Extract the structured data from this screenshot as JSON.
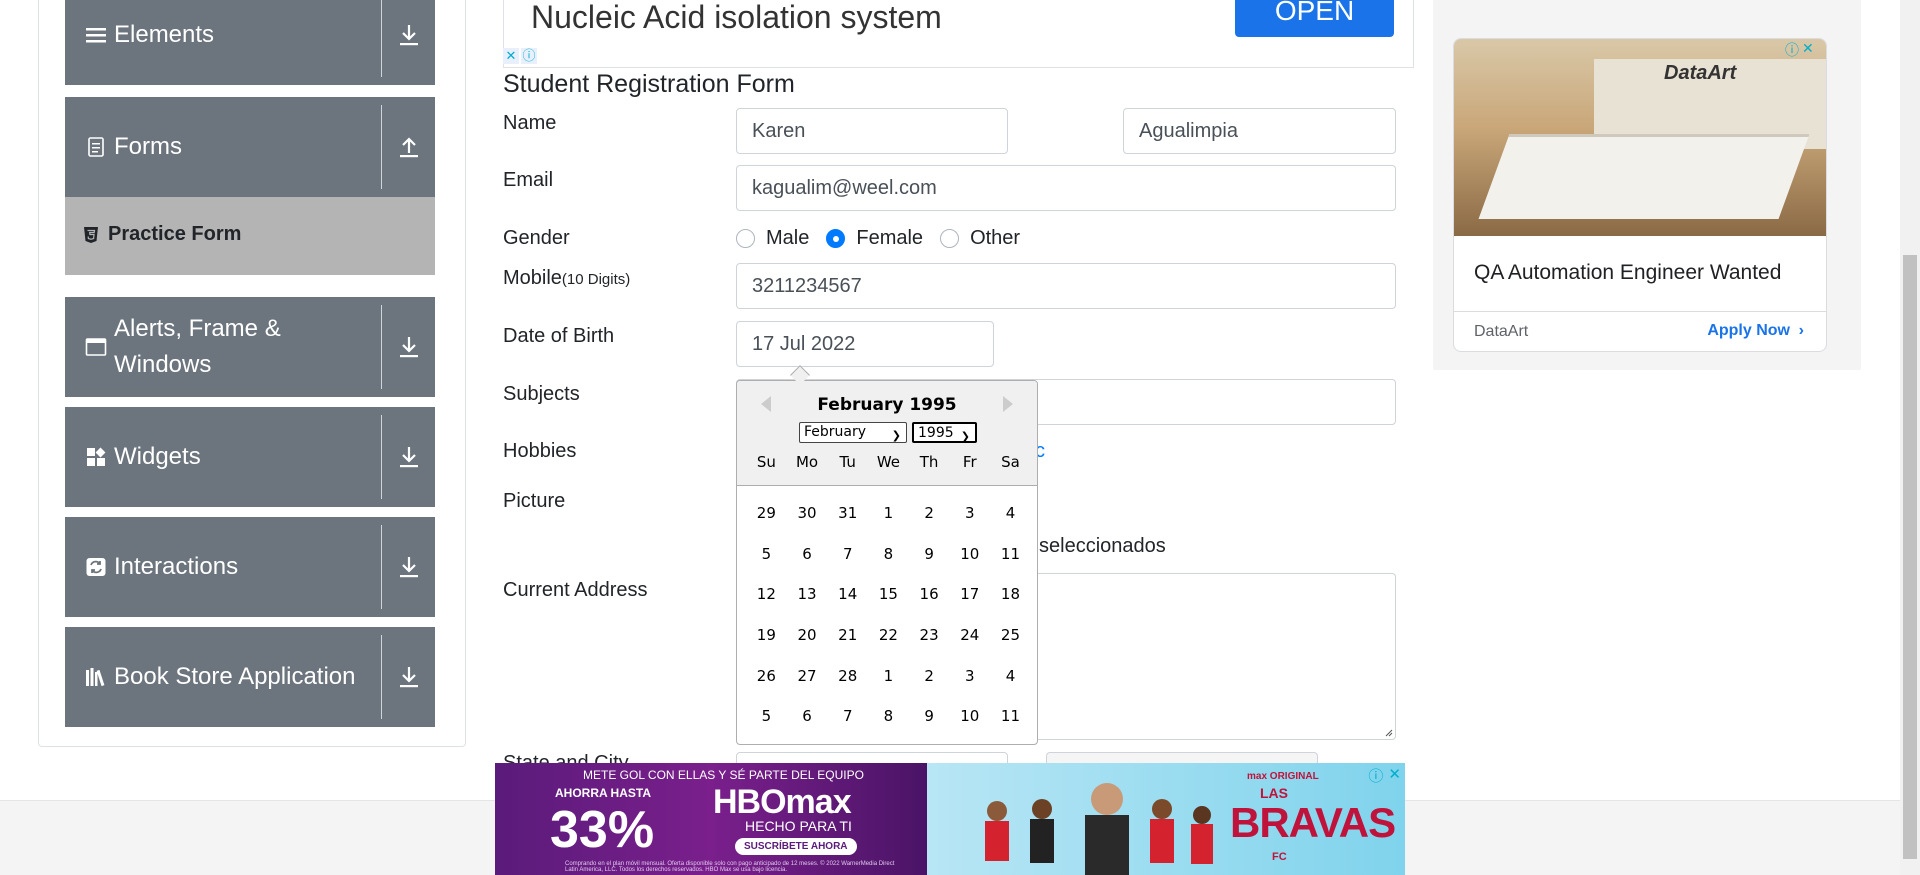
{
  "sidebar": {
    "groups": [
      {
        "label": "Elements",
        "icon": "list-icon",
        "toggle": "download-arrow-icon"
      },
      {
        "label": "Forms",
        "icon": "document-icon",
        "toggle": "upload-arrow-icon"
      },
      {
        "label": "Alerts, Frame & Windows",
        "icon": "window-icon",
        "toggle": "download-arrow-icon"
      },
      {
        "label": "Widgets",
        "icon": "widgets-icon",
        "toggle": "download-arrow-icon"
      },
      {
        "label": "Interactions",
        "icon": "interactions-icon",
        "toggle": "download-arrow-icon"
      },
      {
        "label": "Book Store Application",
        "icon": "books-icon",
        "toggle": "download-arrow-icon"
      }
    ],
    "active_item": {
      "label": "Practice Form",
      "icon": "html5-icon"
    }
  },
  "top_ad": {
    "text": "Nucleic Acid isolation system",
    "button": "OPEN"
  },
  "form": {
    "title": "Student Registration Form",
    "name_label": "Name",
    "first_name": "Karen",
    "last_name": "Agualimpia",
    "email_label": "Email",
    "email": "kagualim@weel.com",
    "gender_label": "Gender",
    "gender_options": [
      "Male",
      "Female",
      "Other"
    ],
    "gender_selected": "Female",
    "mobile_label": "Mobile",
    "mobile_hint": "(10 Digits)",
    "mobile": "3211234567",
    "dob_label": "Date of Birth",
    "dob": "17 Jul 2022",
    "subjects_label": "Subjects",
    "hobbies_label": "Hobbies",
    "hobbies_peek": "c",
    "picture_label": "Picture",
    "picture_status_peek": "seleccionados",
    "address_label": "Current Address",
    "state_city_label_peek": "State and City"
  },
  "datepicker": {
    "title": "February 1995",
    "month_select": "February",
    "year_select": "1995",
    "day_names": [
      "Su",
      "Mo",
      "Tu",
      "We",
      "Th",
      "Fr",
      "Sa"
    ],
    "weeks": [
      [
        "29",
        "30",
        "31",
        "1",
        "2",
        "3",
        "4"
      ],
      [
        "5",
        "6",
        "7",
        "8",
        "9",
        "10",
        "11"
      ],
      [
        "12",
        "13",
        "14",
        "15",
        "16",
        "17",
        "18"
      ],
      [
        "19",
        "20",
        "21",
        "22",
        "23",
        "24",
        "25"
      ],
      [
        "26",
        "27",
        "28",
        "1",
        "2",
        "3",
        "4"
      ],
      [
        "5",
        "6",
        "7",
        "8",
        "9",
        "10",
        "11"
      ]
    ]
  },
  "right_ad": {
    "logo": "DataArt",
    "headline": "QA Automation Engineer Wanted",
    "brand": "DataArt",
    "cta": "Apply Now"
  },
  "bottom_ad": {
    "top_line": "METE GOL CON ELLAS Y SÉ PARTE DEL EQUIPO",
    "ahorra": "AHORRA HASTA",
    "percent": "33%",
    "brand": "HBOmax",
    "tagline": "HECHO PARA TI",
    "cta": "SUSCRÍBETE AHORA",
    "fine_print": "Comprando en el plan móvil mensual. Oferta disponible solo con pago anticipado de 12 meses. © 2022 WarnerMedia Direct Latin America, LLC. Todos los derechos reservados. HBO Max se usa bajo licencia.",
    "max_original": "max ORIGINAL",
    "show_las": "LAS",
    "show_title": "BRAVAS",
    "show_fc": "FC"
  },
  "colors": {
    "sidebar_group_bg": "#6c757d",
    "active_item_bg": "#b4b4b4",
    "accent": "#007bff",
    "ad_blue": "#1a73e8"
  }
}
